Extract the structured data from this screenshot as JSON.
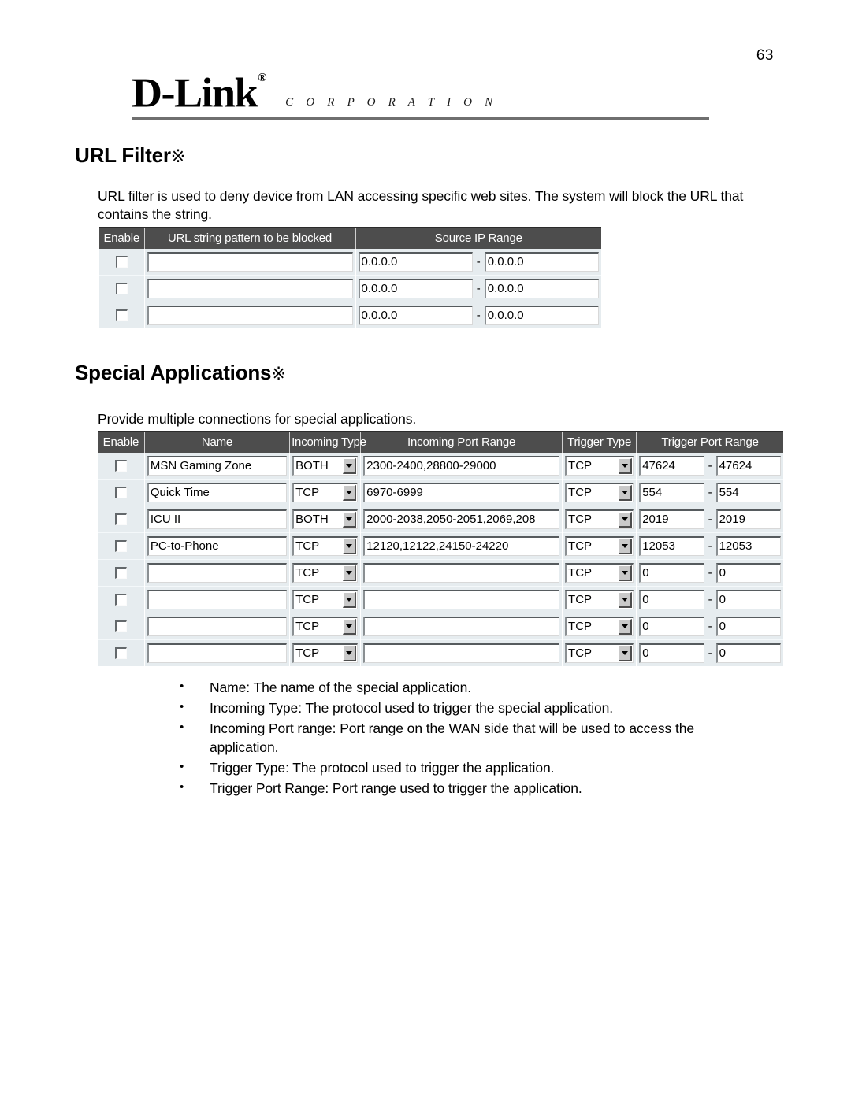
{
  "page": {
    "number": "63"
  },
  "header": {
    "logo_text": "D-Link",
    "logo_trademark": "®",
    "logo_subtitle": "C O R P O R A T I O N"
  },
  "sections": {
    "url_filter": {
      "heading": "URL Filter",
      "heading_mark": "※",
      "paragraph": "URL filter is used to deny device from LAN accessing specific web sites. The system will block the URL that contains the string.",
      "table": {
        "headers": [
          "Enable",
          "URL string pattern to be blocked",
          "Source IP Range"
        ],
        "range_separator": "-",
        "rows": [
          {
            "enabled": false,
            "pattern": "",
            "ip_from": "0.0.0.0",
            "ip_to": "0.0.0.0"
          },
          {
            "enabled": false,
            "pattern": "",
            "ip_from": "0.0.0.0",
            "ip_to": "0.0.0.0"
          },
          {
            "enabled": false,
            "pattern": "",
            "ip_from": "0.0.0.0",
            "ip_to": "0.0.0.0"
          }
        ]
      }
    },
    "special_applications": {
      "heading": "Special Applications",
      "heading_mark": "※",
      "paragraph": "Provide multiple connections for special applications.",
      "table": {
        "headers": [
          "Enable",
          "Name",
          "Incoming Type",
          "Incoming Port Range",
          "Trigger Type",
          "Trigger Port Range"
        ],
        "range_separator": "-",
        "rows": [
          {
            "enabled": false,
            "name": "MSN Gaming Zone",
            "incoming_type": "BOTH",
            "incoming_port_range": "2300-2400,28800-29000",
            "trigger_type": "TCP",
            "trigger_from": "47624",
            "trigger_to": "47624"
          },
          {
            "enabled": false,
            "name": "Quick Time",
            "incoming_type": "TCP",
            "incoming_port_range": "6970-6999",
            "trigger_type": "TCP",
            "trigger_from": "554",
            "trigger_to": "554"
          },
          {
            "enabled": false,
            "name": "ICU II",
            "incoming_type": "BOTH",
            "incoming_port_range": "2000-2038,2050-2051,2069,208",
            "trigger_type": "TCP",
            "trigger_from": "2019",
            "trigger_to": "2019"
          },
          {
            "enabled": false,
            "name": "PC-to-Phone",
            "incoming_type": "TCP",
            "incoming_port_range": "12120,12122,24150-24220",
            "trigger_type": "TCP",
            "trigger_from": "12053",
            "trigger_to": "12053"
          },
          {
            "enabled": false,
            "name": "",
            "incoming_type": "TCP",
            "incoming_port_range": "",
            "trigger_type": "TCP",
            "trigger_from": "0",
            "trigger_to": "0"
          },
          {
            "enabled": false,
            "name": "",
            "incoming_type": "TCP",
            "incoming_port_range": "",
            "trigger_type": "TCP",
            "trigger_from": "0",
            "trigger_to": "0"
          },
          {
            "enabled": false,
            "name": "",
            "incoming_type": "TCP",
            "incoming_port_range": "",
            "trigger_type": "TCP",
            "trigger_from": "0",
            "trigger_to": "0"
          },
          {
            "enabled": false,
            "name": "",
            "incoming_type": "TCP",
            "incoming_port_range": "",
            "trigger_type": "TCP",
            "trigger_from": "0",
            "trigger_to": "0"
          }
        ]
      },
      "bullets": [
        "Name: The name of the special application.",
        "Incoming Type: The protocol used to trigger the special application.",
        "Incoming Port range: Port range on the WAN side that will be used to access the application.",
        "Trigger Type: The protocol used to trigger the application.",
        "Trigger Port Range: Port range used to trigger the application."
      ]
    }
  }
}
